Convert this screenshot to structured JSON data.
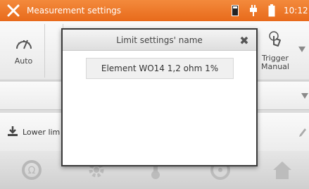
{
  "topbar": {
    "title": "Measurement settings",
    "clock": "10:12",
    "icons": [
      "tools-icon",
      "sd-card-icon",
      "plug-icon",
      "battery-icon"
    ]
  },
  "tiles": {
    "auto_label": "Auto",
    "trigger_label": "Trigger\nManual"
  },
  "lower_label": "Lower lim",
  "dialog": {
    "title": "Limit settings' name",
    "value": "Element WO14 1,2 ohm 1%"
  },
  "colors": {
    "accent": "#e8731f",
    "dialog_border": "#3a3a3a"
  },
  "bottombar": {
    "icons": [
      "measure-icon",
      "settings-icon",
      "thermometer-icon",
      "gauge-icon",
      "home-icon"
    ]
  }
}
